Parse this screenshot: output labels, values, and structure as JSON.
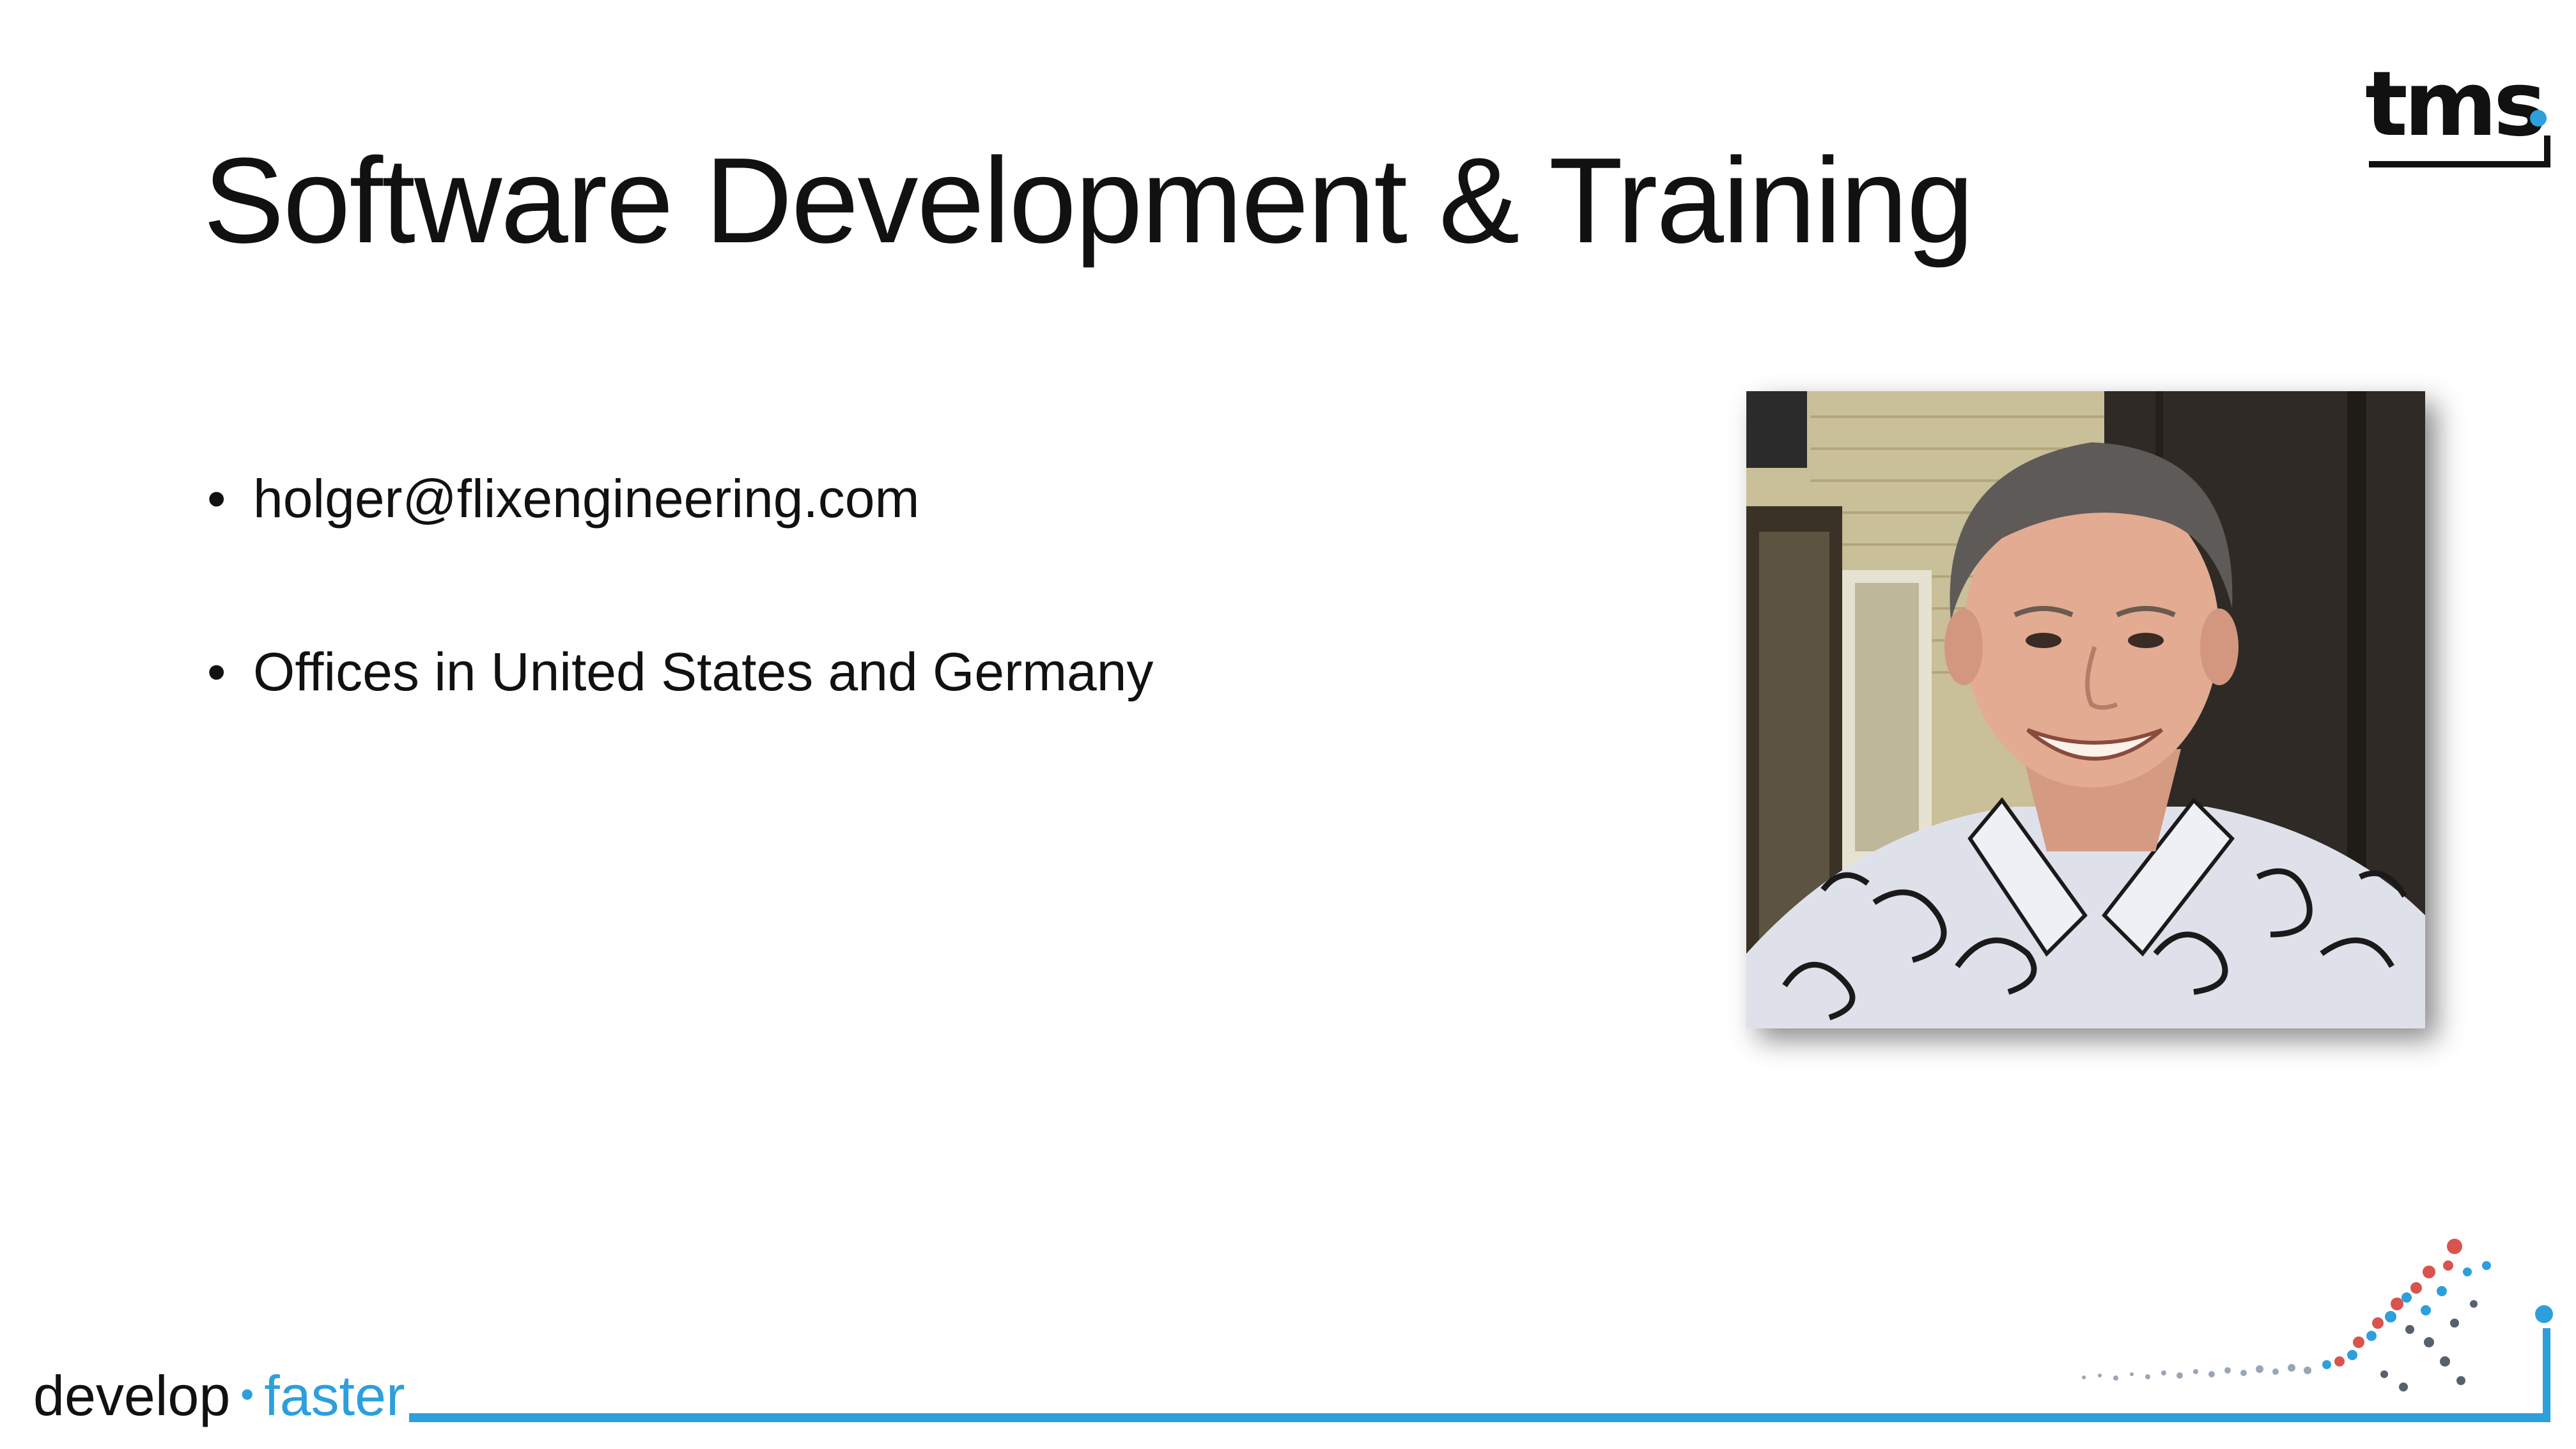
{
  "slide": {
    "title": "Software Development & Training",
    "bullets": [
      "holger@flixengineering.com",
      "Offices in United States and Germany"
    ],
    "bullet_glyph": "•",
    "photo": {
      "alt": "portrait-photo"
    }
  },
  "brand": {
    "logo_text": "tms",
    "tagline_word1": "develop",
    "tagline_separator": "•",
    "tagline_word2": "faster",
    "accent_color": "#2d9fdc",
    "text_color": "#111111"
  }
}
